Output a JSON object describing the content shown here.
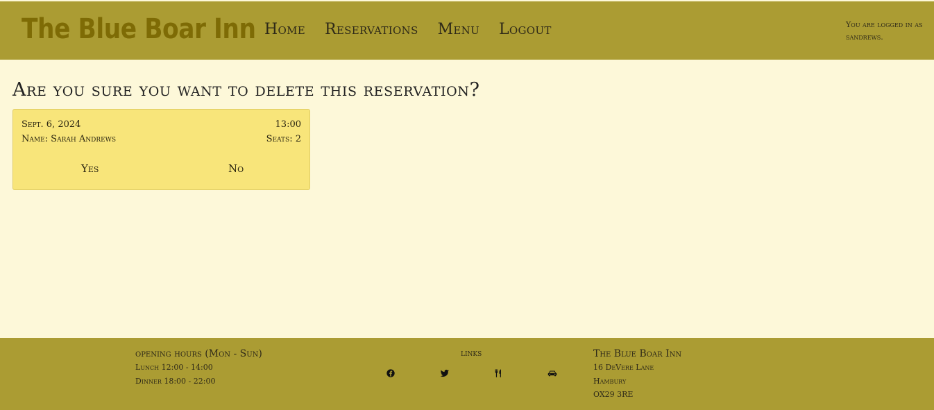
{
  "header": {
    "brand": "The Blue Boar Inn",
    "nav": [
      "Home",
      "Reservations",
      "Menu",
      "Logout"
    ],
    "login_status": "You are logged in as sandrews."
  },
  "main": {
    "heading": "Are you sure you want to delete this reservation?",
    "reservation": {
      "date": "Sept. 6, 2024",
      "time": "13:00",
      "name": "Name: Sarah Andrews",
      "seats": "Seats: 2"
    },
    "confirm_yes": "Yes",
    "confirm_no": "No"
  },
  "footer": {
    "hours_title": "opening hours (Mon - Sun)",
    "lunch": "Lunch  12:00 - 14:00",
    "dinner": "Dinner 18:00 - 22:00",
    "links_title": "links",
    "link_icons": [
      "facebook-icon",
      "twitter-icon",
      "menu-icon",
      "car-icon"
    ],
    "address_title": "The Blue Boar Inn",
    "address_line1": "16 DeVere Lane",
    "address_line2": "Hambury",
    "address_line3": "OX29 3RE"
  },
  "colors": {
    "header_bg": "#ab9c33",
    "page_bg": "#fdf8d9",
    "card_bg": "#f8e57a",
    "brand_text": "#7e6b05"
  }
}
